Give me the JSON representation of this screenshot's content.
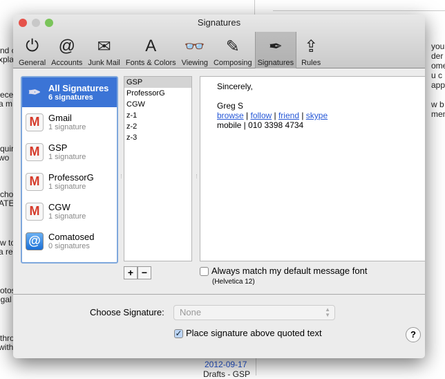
{
  "background": {
    "left_fragments": [
      "nd c",
      "xpla",
      "ecei",
      "a m",
      "quiry",
      "wo",
      "chos",
      "ATE",
      "w to",
      "a re",
      "otos",
      "igal",
      "thro",
      "with"
    ],
    "right_fragments": [
      "you",
      "der",
      "ome",
      "u c",
      "app",
      "w b",
      "men"
    ],
    "date": "2012-09-17",
    "folder": "Drafts - GSP"
  },
  "window": {
    "title": "Signatures"
  },
  "toolbar": [
    {
      "label": "General",
      "icon": "switch-icon"
    },
    {
      "label": "Accounts",
      "icon": "at-icon"
    },
    {
      "label": "Junk Mail",
      "icon": "junk-icon"
    },
    {
      "label": "Fonts & Colors",
      "icon": "fonts-icon"
    },
    {
      "label": "Viewing",
      "icon": "glasses-icon"
    },
    {
      "label": "Composing",
      "icon": "pencil-icon"
    },
    {
      "label": "Signatures",
      "icon": "pen-icon"
    },
    {
      "label": "Rules",
      "icon": "rules-icon"
    }
  ],
  "accounts": [
    {
      "name": "All Signatures",
      "count": "6 signatures",
      "icon": "pen-icon"
    },
    {
      "name": "Gmail",
      "count": "1 signature",
      "icon": "gmail-icon"
    },
    {
      "name": "GSP",
      "count": "1 signature",
      "icon": "gmail-icon"
    },
    {
      "name": "ProfessorG",
      "count": "1 signature",
      "icon": "gmail-icon"
    },
    {
      "name": "CGW",
      "count": "1 signature",
      "icon": "gmail-icon"
    },
    {
      "name": "Comatosed",
      "count": "0 signatures",
      "icon": "at-icon"
    }
  ],
  "signatures": [
    "GSP",
    "ProfessorG",
    "CGW",
    "z-1",
    "z-2",
    "z-3"
  ],
  "editor": {
    "line1": "Sincerely,",
    "name": "Greg S",
    "links": [
      "browse",
      "follow",
      "friend",
      "skype"
    ],
    "sep": " | ",
    "mobile": "mobile  | 010 3398 4734"
  },
  "buttons": {
    "add": "+",
    "remove": "−",
    "help": "?"
  },
  "match_font": {
    "label": "Always match my default message font",
    "font": "(Helvetica 12)",
    "checked": false
  },
  "choose": {
    "label": "Choose Signature:",
    "value": "None"
  },
  "place_above": {
    "label": "Place signature above quoted text",
    "checked": true
  },
  "colors": {
    "selection": "#3b74d6",
    "link": "#2456d6"
  }
}
